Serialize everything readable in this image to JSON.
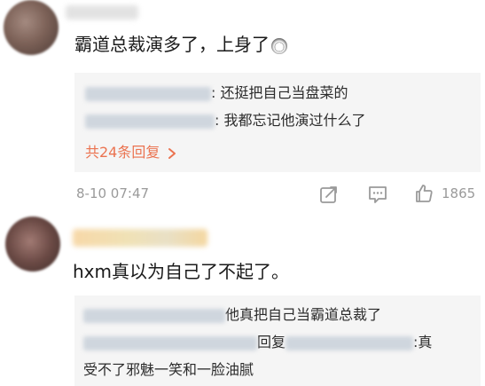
{
  "comments": [
    {
      "text": "霸道总裁演多了，上身了",
      "emoji": "husky-dog-emoji",
      "replies": [
        {
          "text": ": 还挺把自己当盘菜的"
        },
        {
          "text": ": 我都忘记他演过什么了"
        }
      ],
      "more_replies_label": "共24条回复",
      "more_replies_chevron": "chevron-right-icon",
      "time": "8-10 07:47",
      "likes": "1865"
    },
    {
      "text": "hxm真以为自己了不起了。",
      "replies": [
        {
          "text": "他真把自己当霸道总裁了"
        },
        {
          "reply_word": "回复",
          "tail": ":真",
          "continuation": "受不了邪魅一笑和一脸油腻"
        }
      ]
    }
  ],
  "icons": {
    "share": "share-icon",
    "comment": "comment-icon",
    "like": "thumbs-up-icon"
  },
  "colors": {
    "accent_link": "#eb7350",
    "meta_gray": "#9a9a9a",
    "reply_bg": "#f5f5f5"
  }
}
